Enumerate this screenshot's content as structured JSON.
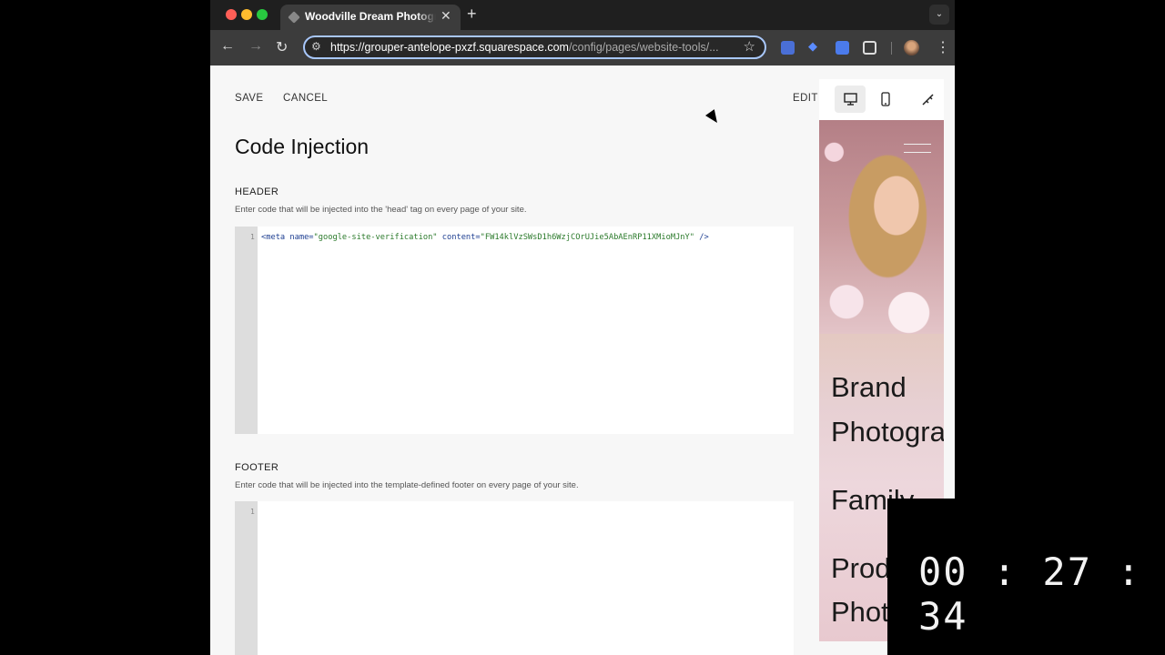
{
  "browser": {
    "tab_title": "Woodville Dream Photograph",
    "close_glyph": "✕",
    "new_tab_glyph": "+",
    "url_domain": "https://grouper-antelope-pxzf.squarespace.com",
    "url_path": "/config/pages/website-tools/...",
    "icons": {
      "back": "←",
      "forward": "→",
      "reload": "↻",
      "site_info": "⚙",
      "star": "☆",
      "menu": "⋮",
      "tab_menu": "⌄"
    }
  },
  "toolbar": {
    "save_label": "SAVE",
    "cancel_label": "CANCEL",
    "edit_label": "EDIT"
  },
  "page": {
    "title": "Code Injection"
  },
  "header_section": {
    "title": "HEADER",
    "description": "Enter code that will be injected into the 'head' tag on every page of your site.",
    "line_number": "1",
    "code": {
      "open": "<meta",
      "attr1": " name=",
      "val1": "\"google-site-verification\"",
      "attr2": " content=",
      "val2": "\"FW14klVzSWsD1h6WzjCOrUJie5AbAEnRP11XMioMJnY\"",
      "close": " />"
    }
  },
  "footer_section": {
    "title": "FOOTER",
    "description": "Enter code that will be injected into the template-defined footer on every page of your site.",
    "line_number": "1"
  },
  "preview": {
    "lines": [
      "Brand",
      "Photogra",
      "Family",
      "Prod",
      "Phot"
    ]
  },
  "timer": {
    "value": "00 : 27 : 34"
  }
}
